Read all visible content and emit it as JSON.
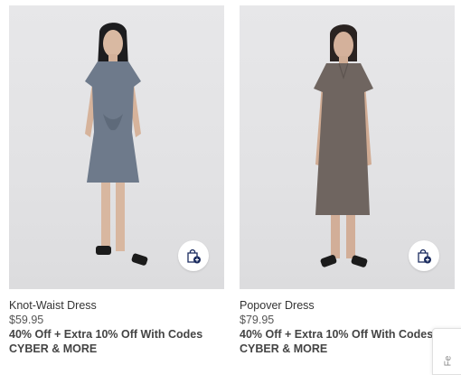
{
  "products": [
    {
      "name": "Knot-Waist Dress",
      "price": "$59.95",
      "promo": "40% Off + Extra 10% Off With Codes",
      "code": "CYBER & MORE",
      "dress_color": "#6e7a8b",
      "bag_icon": "shopping-bag-add-icon"
    },
    {
      "name": "Popover Dress",
      "price": "$79.95",
      "promo": "40% Off + Extra 10% Off With Codes",
      "code": "CYBER & MORE",
      "dress_color": "#6f6560",
      "bag_icon": "shopping-bag-add-icon"
    }
  ],
  "feedback_tab": {
    "label": "Fe"
  },
  "colors": {
    "accent": "#1a2b5f",
    "background": "#e4e4e6"
  }
}
